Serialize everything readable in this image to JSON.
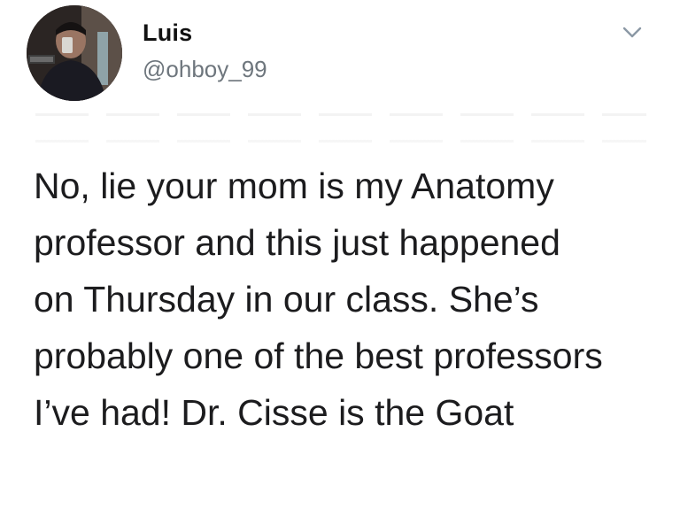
{
  "user": {
    "display_name": "Luis",
    "handle": "@ohboy_99",
    "avatar_icon": "profile-photo"
  },
  "menu_icon": "chevron-down-icon",
  "tweet": {
    "lines": [
      "No, lie your mom is my Anatomy",
      "professor and this just happened",
      "on Thursday in our class. She’s",
      "probably one of the best professors",
      "I’ve had! Dr. Cisse is the Goat"
    ]
  },
  "colors": {
    "text": "#1c1c1e",
    "handle": "#6e767d",
    "chevron": "#8b98a5"
  }
}
